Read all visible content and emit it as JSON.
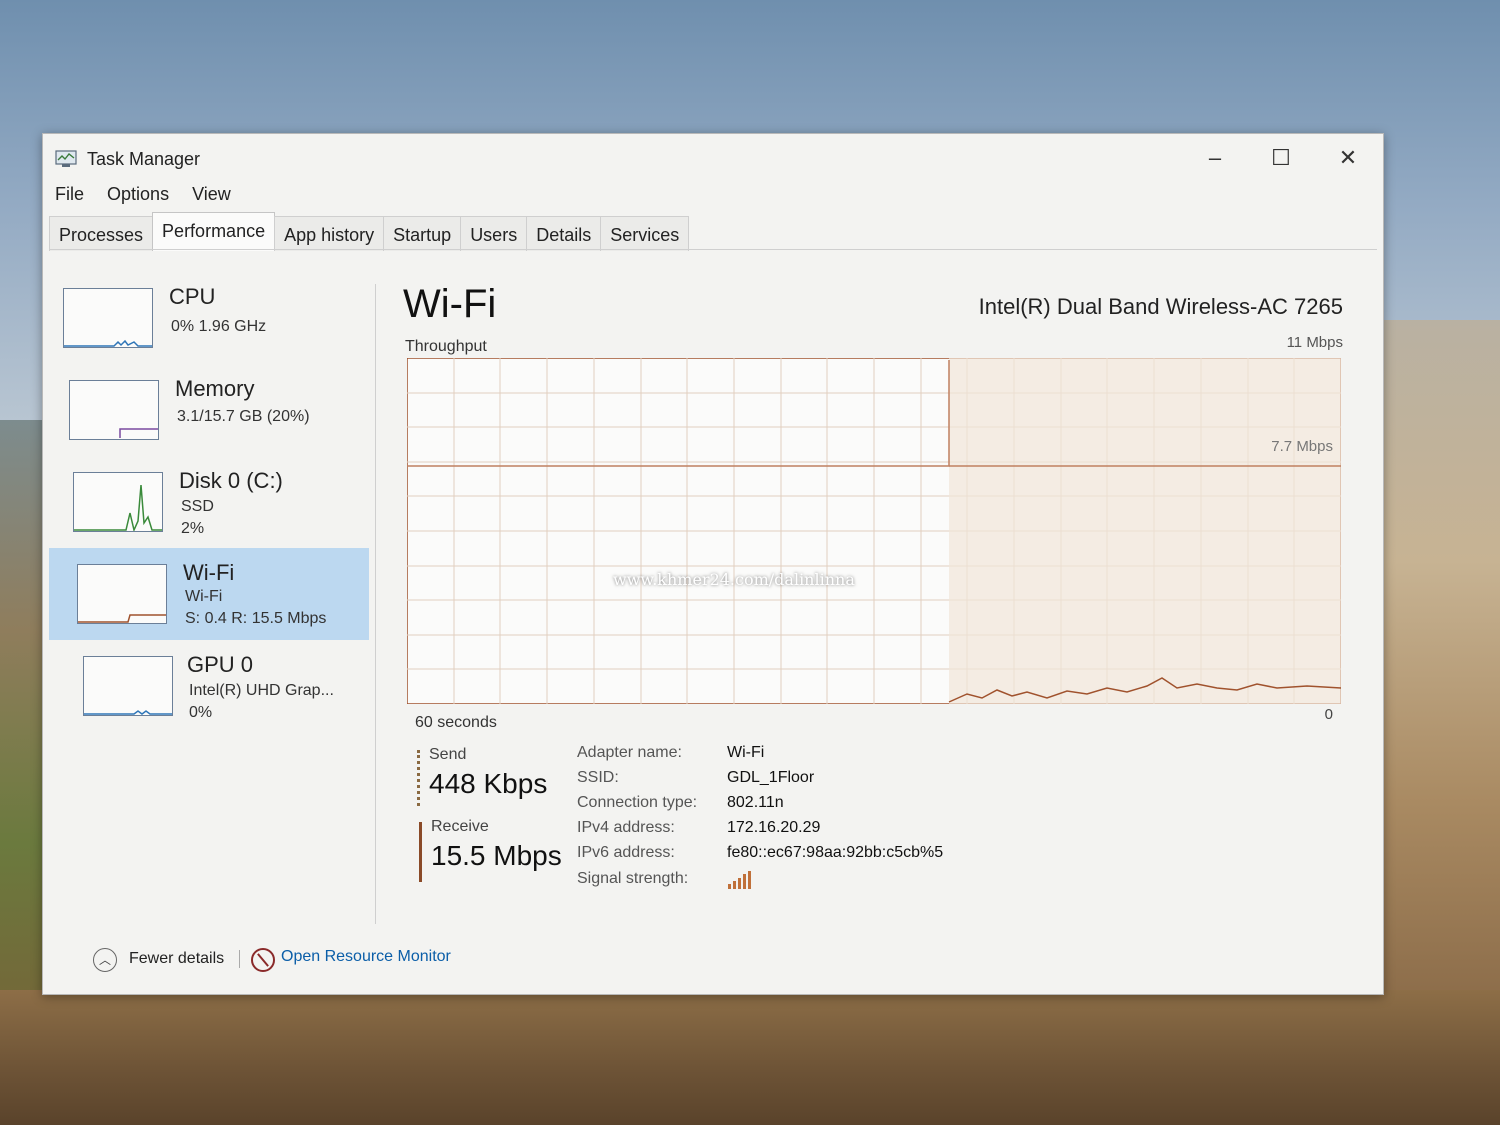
{
  "window": {
    "title": "Task Manager",
    "minimize": "–",
    "maximize": "☐",
    "close": "✕"
  },
  "menu": [
    "File",
    "Options",
    "View"
  ],
  "tabs": [
    "Processes",
    "Performance",
    "App history",
    "Startup",
    "Users",
    "Details",
    "Services"
  ],
  "active_tab": "Performance",
  "sidebar": {
    "items": [
      {
        "name": "CPU",
        "line1": "0%  1.96 GHz",
        "line2": ""
      },
      {
        "name": "Memory",
        "line1": "3.1/15.7 GB (20%)",
        "line2": ""
      },
      {
        "name": "Disk 0 (C:)",
        "line1": "SSD",
        "line2": "2%"
      },
      {
        "name": "Wi-Fi",
        "line1": "Wi-Fi",
        "line2": "S: 0.4  R: 15.5 Mbps"
      },
      {
        "name": "GPU 0",
        "line1": "Intel(R) UHD Grap...",
        "line2": "0%"
      }
    ],
    "active_index": 3
  },
  "main": {
    "title": "Wi-Fi",
    "adapter_model": "Intel(R) Dual Band Wireless-AC 7265",
    "throughput_label": "Throughput",
    "max_label": "11 Mbps",
    "scale_label": "7.7 Mbps",
    "time_label": "60 seconds",
    "zero_label": "0"
  },
  "stats": {
    "send_label": "Send",
    "send_value": "448 Kbps",
    "receive_label": "Receive",
    "receive_value": "15.5 Mbps"
  },
  "properties": [
    {
      "key": "Adapter name:",
      "value": "Wi-Fi"
    },
    {
      "key": "SSID:",
      "value": "GDL_1Floor"
    },
    {
      "key": "Connection type:",
      "value": "802.11n"
    },
    {
      "key": "IPv4 address:",
      "value": "172.16.20.29"
    },
    {
      "key": "IPv6 address:",
      "value": "fe80::ec67:98aa:92bb:c5cb%5"
    },
    {
      "key": "Signal strength:",
      "value": ""
    }
  ],
  "footer": {
    "fewer_details": "Fewer details",
    "open_resource_monitor": "Open Resource Monitor"
  },
  "watermark": "www.khmer24.com/dalinlinna",
  "colors": {
    "accent": "#bcd8f0",
    "graph_line": "#a0522d",
    "graph_grid": "#e2cfc0",
    "link": "#0b5ea8"
  }
}
